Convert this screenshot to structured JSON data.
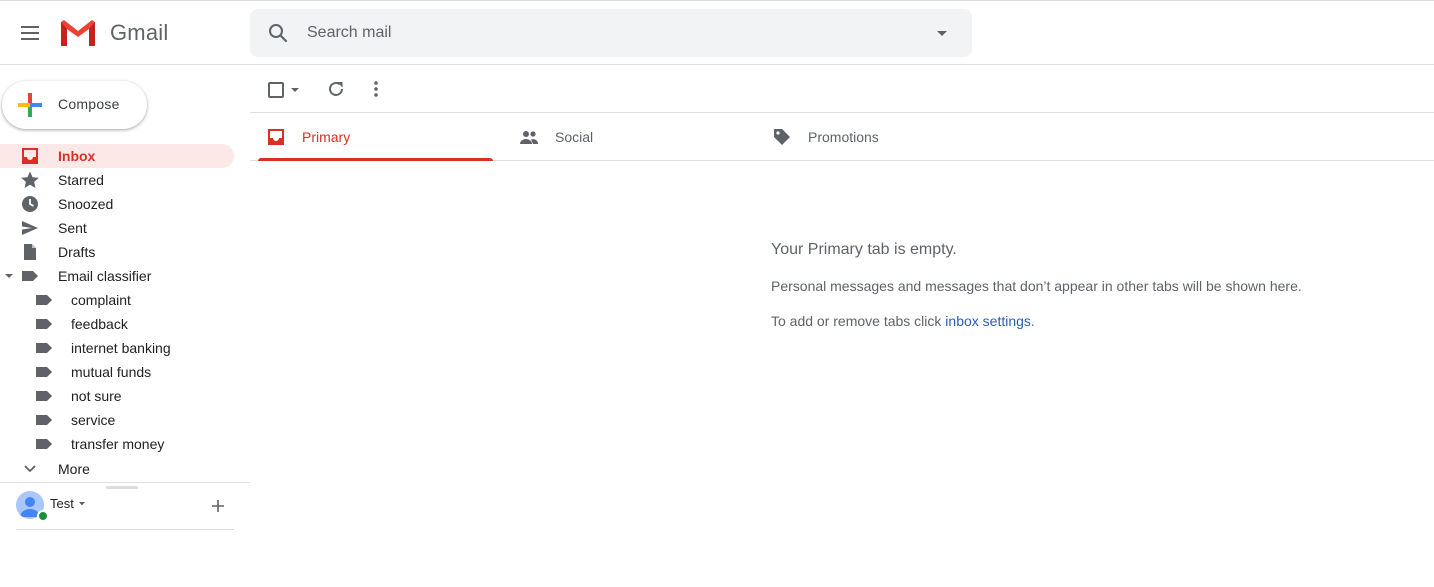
{
  "app": {
    "brand": "Gmail"
  },
  "search": {
    "placeholder": "Search mail"
  },
  "compose": {
    "label": "Compose"
  },
  "sidebar": {
    "items": [
      {
        "label": "Inbox",
        "icon": "inbox-icon",
        "active": true
      },
      {
        "label": "Starred",
        "icon": "star-icon"
      },
      {
        "label": "Snoozed",
        "icon": "clock-icon"
      },
      {
        "label": "Sent",
        "icon": "send-icon"
      },
      {
        "label": "Drafts",
        "icon": "draft-icon"
      },
      {
        "label": "Email classifier",
        "icon": "label-icon",
        "expanded": true
      }
    ],
    "sublabels": [
      {
        "label": "complaint",
        "icon": "label-icon"
      },
      {
        "label": "feedback",
        "icon": "label-icon"
      },
      {
        "label": "internet banking",
        "icon": "label-icon"
      },
      {
        "label": "mutual funds",
        "icon": "label-icon"
      },
      {
        "label": "not sure",
        "icon": "label-icon"
      },
      {
        "label": "service",
        "icon": "label-icon"
      },
      {
        "label": "transfer money",
        "icon": "label-icon"
      }
    ],
    "more_label": "More"
  },
  "account": {
    "name": "Test",
    "status_color": "#1e8e3e"
  },
  "tabs": [
    {
      "label": "Primary",
      "icon": "inbox-icon",
      "active": true
    },
    {
      "label": "Social",
      "icon": "people-icon"
    },
    {
      "label": "Promotions",
      "icon": "tag-icon"
    }
  ],
  "empty_state": {
    "title": "Your Primary tab is empty.",
    "description": "Personal messages and messages that don’t appear in other tabs will be shown here.",
    "settings_prefix": "To add or remove tabs click ",
    "settings_link": "inbox settings",
    "settings_suffix": "."
  },
  "colors": {
    "accent": "#d93025",
    "active_bg": "#fce8e6",
    "link": "#2a5db0"
  }
}
